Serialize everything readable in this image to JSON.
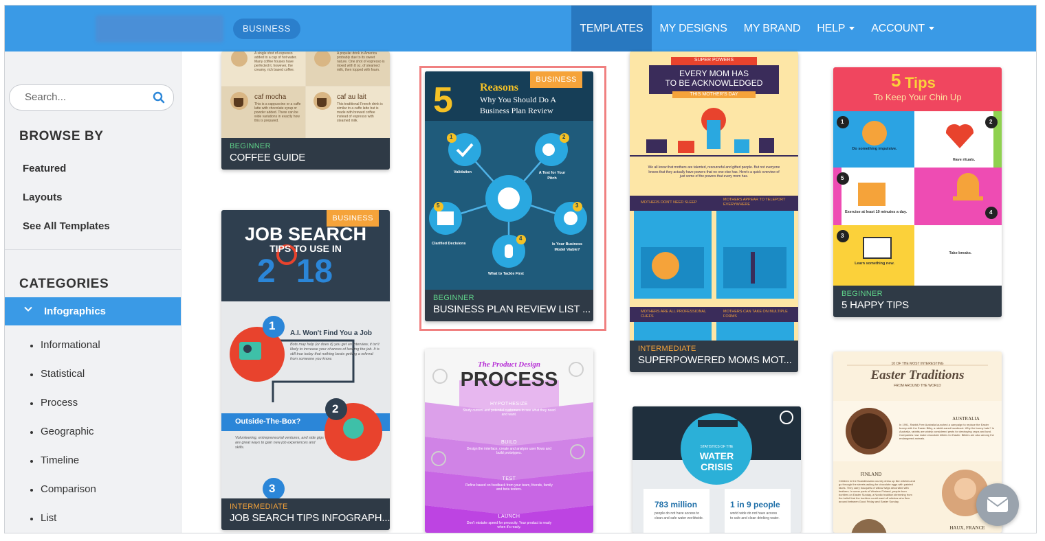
{
  "header": {
    "category_pill": "BUSINESS",
    "nav": [
      {
        "label": "TEMPLATES",
        "active": true,
        "dropdown": false
      },
      {
        "label": "MY DESIGNS",
        "active": false,
        "dropdown": false
      },
      {
        "label": "MY BRAND",
        "active": false,
        "dropdown": false
      },
      {
        "label": "HELP",
        "active": false,
        "dropdown": true
      },
      {
        "label": "ACCOUNT",
        "active": false,
        "dropdown": true
      }
    ]
  },
  "sidebar": {
    "search_placeholder": "Search...",
    "browse_heading": "BROWSE BY",
    "browse_links": [
      "Featured",
      "Layouts",
      "See All Templates"
    ],
    "categories_heading": "CATEGORIES",
    "active_category": "Infographics",
    "subcategories": [
      "Informational",
      "Statistical",
      "Process",
      "Geographic",
      "Timeline",
      "Comparison",
      "List"
    ]
  },
  "cards": {
    "coffee": {
      "level": "BEGINNER",
      "title": "COFFEE GUIDE",
      "cell1_title": "caf mocha",
      "cell1_text": "This is a cappuccino or a caffe latte with chocolate syrup or powder added. There can be wide variations in exactly how this is prepared.",
      "cell2_title": "caf au lait",
      "cell2_text": "This traditional French drink is similar to a caffe latte but is made with brewed coffee instead of espresso with steamed milk.",
      "top1_text": "A single shot of espresso added to a cup of hot water. Many coffee houses have perfected it, however, the creamy, rich based coffee.",
      "top2_text": "A popular drink in America probably due to its sweet nature. One shot of espresso is mixed with 8 oz. of steamed milk, then topped with foam."
    },
    "business_plan": {
      "badge": "BUSINESS",
      "level": "BEGINNER",
      "title": "BUSINESS PLAN REVIEW LIST ...",
      "big_num": "5",
      "heading1": "Reasons",
      "heading2": "Why You Should Do A",
      "heading3": "Business Plan Review",
      "items": [
        {
          "num": "1",
          "label": "Validation"
        },
        {
          "num": "2",
          "label": "A Test for Your Pitch"
        },
        {
          "num": "3",
          "label": "Is Your Business Model Viable?"
        },
        {
          "num": "4",
          "label": "What to Tackle First"
        },
        {
          "num": "5",
          "label": "Clarified Decisions"
        }
      ]
    },
    "moms": {
      "level": "INTERMEDIATE",
      "title": "SUPERPOWERED MOMS MOT...",
      "tag": "SUPER POWERS",
      "heading1": "EVERY MOM HAS",
      "heading2": "TO BE ACKNOWLEDGED",
      "sub": "THIS MOTHER'S DAY",
      "intro": "We all know that mothers are talented, resourceful and gifted people. But not everyone knows that they actually have powers that no one else has. Here's a quick overview of just some of the powers that every mom has.",
      "box1": "MOTHERS DON'T NEED SLEEP",
      "box2": "MOTHERS APPEAR TO TELEPORT EVERYWHERE",
      "box3": "MOTHERS ARE ALL PROFESSIONAL CHEFS",
      "box4": "MOTHERS CAN TAKE ON MULTIPLE FORMS"
    },
    "tips": {
      "level": "BEGINNER",
      "title": "5 HAPPY TIPS",
      "big_num": "5",
      "heading": "Tips",
      "sub": "To Keep Your Chin Up",
      "items": [
        {
          "num": "1",
          "title": "Do something impulsive."
        },
        {
          "num": "2",
          "title": "Have rituals."
        },
        {
          "num": "3",
          "title": "Exercise at least 10 minutes a day."
        },
        {
          "num": "4",
          "title": "Take breaks."
        },
        {
          "num": "5",
          "title": "Learn something new."
        }
      ]
    },
    "job": {
      "badge": "BUSINESS",
      "level": "INTERMEDIATE",
      "title": "JOB SEARCH TIPS INFOGRAPH...",
      "heading1": "JOB SEARCH",
      "heading2": "TIPS TO USE IN",
      "year_a": "2",
      "year_b": "18",
      "tip1": "A.I. Won't Find You a Job",
      "tip1_text": "Bots may help (or does it) you get an interview, it isn't likely to increase your chances of landing the job. It is still true today that nothing beats getting a referral from someone you know.",
      "tip2": "Outside-The-Box?",
      "tip2_text": "Volunteering, entrepreneurial ventures, and side gigs are great ways to gain new job experiences and skills.",
      "nums": [
        "1",
        "2",
        "3"
      ]
    },
    "process": {
      "script": "The Product Design",
      "heading": "PROCESS",
      "steps": [
        {
          "label": "HYPOTHESIZE",
          "text": "Study current and potential customers to see what they need and want."
        },
        {
          "label": "BUILD",
          "text": "Design the interface, create and analyze user flows and build prototypes."
        },
        {
          "label": "TEST",
          "text": "Refine based on feedback from your team, friends, family and beta testers."
        },
        {
          "label": "LAUNCH",
          "text": "Don't mistake speed for precocity. Your product is ready when it's ready."
        }
      ]
    },
    "water": {
      "top": "STATISTICS OF THE",
      "heading1": "WATER",
      "heading2": "CRISIS",
      "stat1": "783 million",
      "stat1_text": "people do not have access to clean and safe water worldwide.",
      "stat2": "1 in 9 people",
      "stat2_text": "world wide do not have access to safe and clean drinking water."
    },
    "easter": {
      "top": "10 OF THE MOST INTERESTING",
      "heading": "Easter Traditions",
      "sub": "FROM AROUND THE WORLD",
      "c1": "AUSTRALIA",
      "c1_text": "In 1991, Rabbit-Free Australia launched a campaign to replace the Easter bunny with the Easter Bilby, a rabbit-eared bandicoot. Why the bunny hate? In Australia, rabbits are widely considered pests for destroying crops and land. Companies now make chocolate bilbies for Easter. Bilbies are also among the endangered animals.",
      "c2": "FINLAND",
      "c2_text": "Children in the Scandinavian country dress up like witches and go through the streets asking for chocolate eggs with painted faces. They carry bouquets of willow twigs decorated with feathers. In some parts of Western Finland, people burn bonfires on Easter Sunday, a Nordic tradition stemming from the belief that the bonfires could ward off witches who flew around between Good Friday and Easter Sunday.",
      "c3": "HAUX, FRANCE"
    }
  },
  "colors": {
    "topbar": "#3a9ae6",
    "nav_active": "#2878c0",
    "accent": "#3a9ae6",
    "badge": "#f5a33a",
    "level_green": "#5fd38a",
    "card_footer": "#2f3a46",
    "selected_outline": "#f08080"
  }
}
